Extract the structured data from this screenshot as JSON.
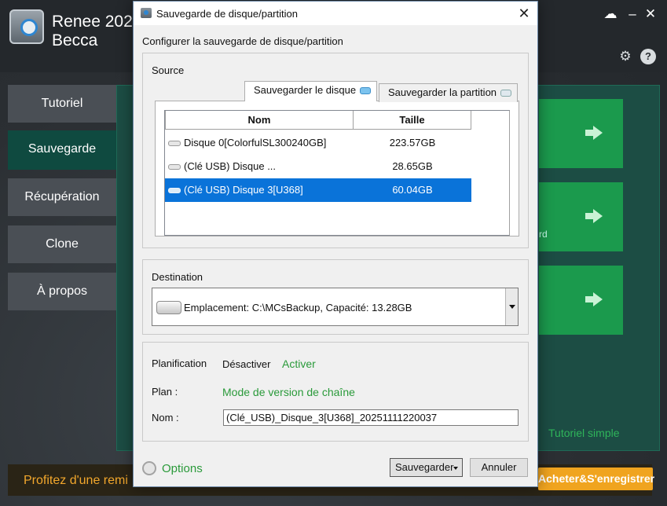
{
  "app": {
    "name": "Renee 202",
    "user": "Becca",
    "nav": [
      "Tutoriel",
      "Sauvegarde",
      "Récupération",
      "Clone",
      "À propos"
    ],
    "active_nav": "Sauvegarde",
    "tile_suffix": "rd",
    "tutorial_link": "Tutoriel simple",
    "promo": "Profitez d'une remi",
    "buy_button": "Acheter&S'enregistrer",
    "accent_green": "#1b9a4d",
    "promo_color": "#f0a41f"
  },
  "dialog": {
    "title": "Sauvegarde de disque/partition",
    "heading": "Configurer la sauvegarde de disque/partition",
    "source": {
      "label": "Source",
      "tabs": [
        "Sauvegarder le disque",
        "Sauvegarder la partition"
      ],
      "active_tab": "Sauvegarder le disque",
      "columns": [
        "Nom",
        "Taille"
      ],
      "rows": [
        {
          "name": "Disque 0[ColorfulSL300240GB]",
          "size": "223.57GB",
          "selected": false
        },
        {
          "name": "(Clé USB) Disque ...",
          "size": "28.65GB",
          "selected": false
        },
        {
          "name": "(Clé USB) Disque 3[U368]",
          "size": "60.04GB",
          "selected": true
        }
      ]
    },
    "destination": {
      "label": "Destination",
      "value": "Emplacement: C:\\MCsBackup, Capacité: 13.28GB"
    },
    "plan": {
      "schedule_label": "Planification",
      "schedule_off": "Désactiver",
      "schedule_on": "Activer",
      "plan_label": "Plan :",
      "plan_value": "Mode de version de chaîne",
      "name_label": "Nom :",
      "name_value": "(Clé_USB)_Disque_3[U368]_20251111220037"
    },
    "footer": {
      "options": "Options",
      "save": "Sauvegarder",
      "cancel": "Annuler"
    },
    "selection_color": "#0a73d9"
  }
}
